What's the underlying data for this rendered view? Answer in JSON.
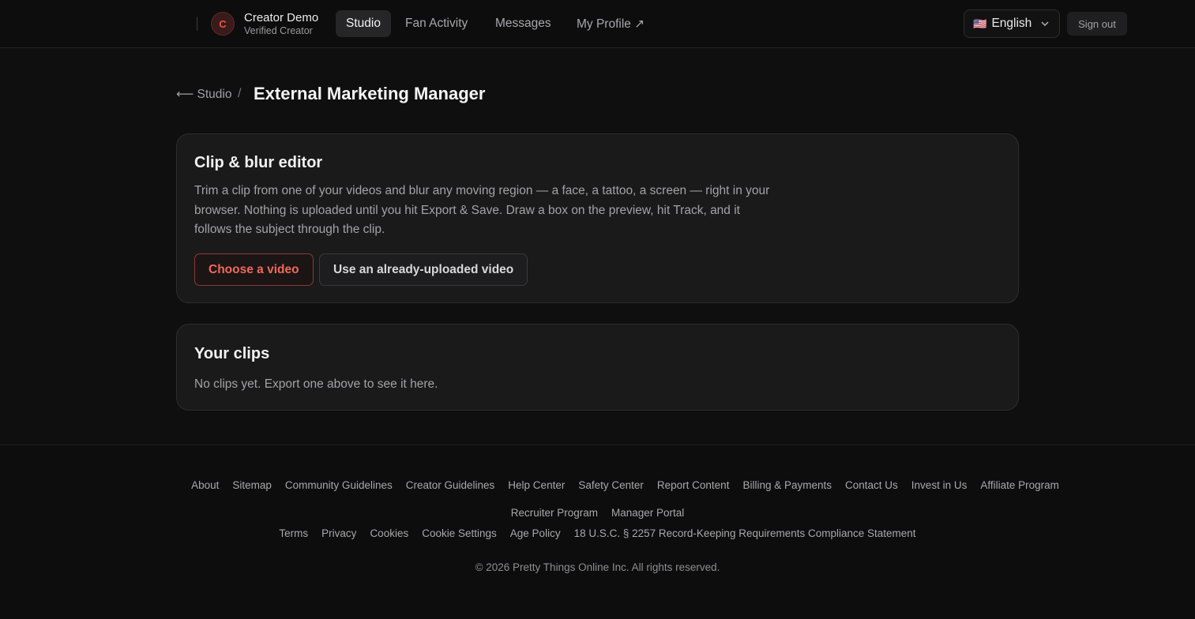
{
  "header": {
    "avatar_initial": "C",
    "user_name": "Creator Demo",
    "user_role": "Verified Creator",
    "tabs": [
      {
        "label": "Studio",
        "active": true
      },
      {
        "label": "Fan Activity",
        "active": false
      },
      {
        "label": "Messages",
        "active": false
      },
      {
        "label": "My Profile ↗",
        "active": false
      }
    ],
    "language": {
      "flag": "🇺🇸",
      "label": "English"
    },
    "sign_out_label": "Sign out"
  },
  "breadcrumb": {
    "back_label": "⟵ Studio",
    "separator": "/",
    "title": "External Marketing Manager"
  },
  "editor_card": {
    "title": "Clip & blur editor",
    "description": "Trim a clip from one of your videos and blur any moving region — a face, a tattoo, a screen — right in your browser. Nothing is uploaded until you hit Export & Save. Draw a box on the preview, hit Track, and it follows the subject through the clip.",
    "choose_button": "Choose a video",
    "uploaded_button": "Use an already-uploaded video"
  },
  "clips_card": {
    "title": "Your clips",
    "empty_text": "No clips yet. Export one above to see it here."
  },
  "footer": {
    "row1": [
      "About",
      "Sitemap",
      "Community Guidelines",
      "Creator Guidelines",
      "Help Center",
      "Safety Center",
      "Report Content",
      "Billing & Payments",
      "Contact Us",
      "Invest in Us",
      "Affiliate Program"
    ],
    "row2": [
      "Recruiter Program",
      "Manager Portal"
    ],
    "row3": [
      "Terms",
      "Privacy",
      "Cookies",
      "Cookie Settings",
      "Age Policy",
      "18 U.S.C. § 2257 Record-Keeping Requirements Compliance Statement"
    ],
    "copyright": "© 2026 Pretty Things Online Inc. All rights reserved."
  },
  "colors": {
    "background": "#0f0f10",
    "card": "#1a1a1b",
    "accent": "#ee6a5c"
  }
}
